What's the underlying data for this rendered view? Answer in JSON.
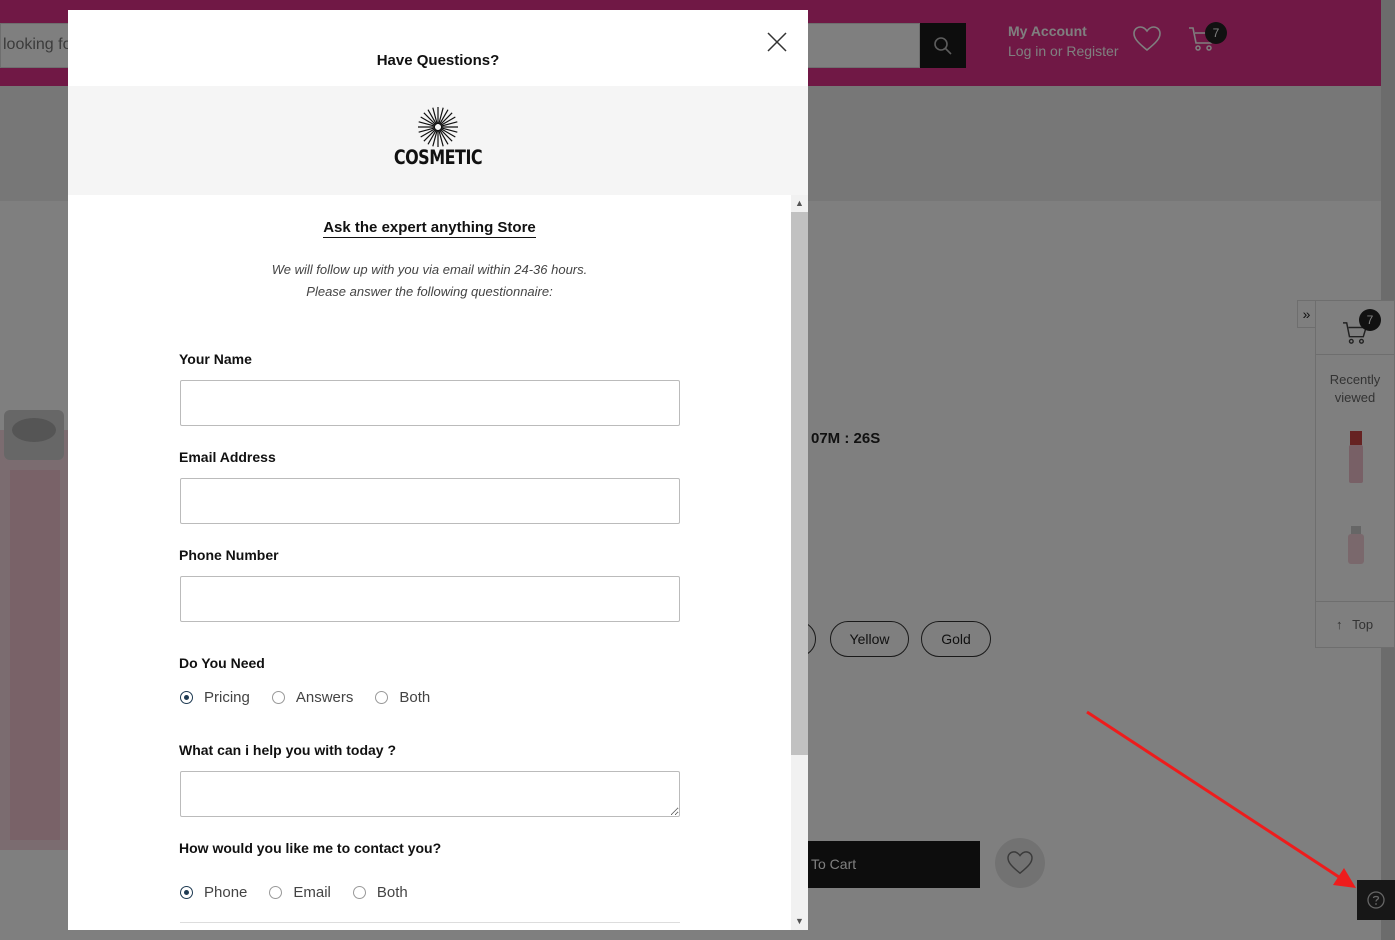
{
  "header": {
    "search_placeholder": "looking fo",
    "account_title": "My Account",
    "account_links": "Log in or Register",
    "cart_count": "7",
    "brand_color": "#e0318a"
  },
  "product": {
    "timer": "07M : 26S",
    "colors": [
      "Yellow",
      "Gold"
    ],
    "add_to_cart": "To Cart"
  },
  "side_panel": {
    "cart_count": "7",
    "recently_viewed": "Recently viewed",
    "top_label": "Top"
  },
  "modal": {
    "title": "Have Questions?",
    "logo_text": "COSMETIC",
    "store_title": "Ask the expert anything Store",
    "intro_line1": "We will follow up with you via email within 24-36 hours.",
    "intro_line2": "Please answer the following questionnaire:",
    "fields": {
      "name_label": "Your Name",
      "name_value": "",
      "email_label": "Email Address",
      "email_value": "",
      "phone_label": "Phone Number",
      "phone_value": "",
      "need_label": "Do You Need",
      "need_options": [
        "Pricing",
        "Answers",
        "Both"
      ],
      "need_selected": "Pricing",
      "help_label": "What can i help you with today ?",
      "help_value": "",
      "contact_label": "How would you like me to contact you?",
      "contact_options": [
        "Phone",
        "Email",
        "Both"
      ],
      "contact_selected": "Phone"
    }
  }
}
